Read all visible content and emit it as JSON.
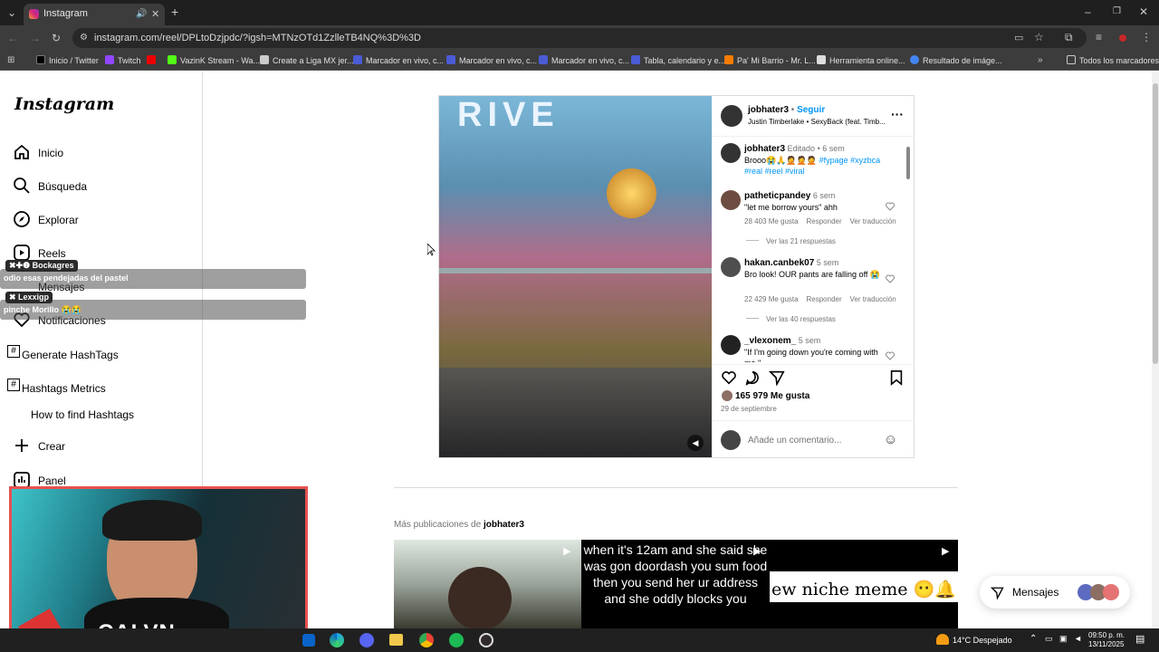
{
  "browser": {
    "tab_title": "Instagram",
    "url": "instagram.com/reel/DPLtoDzjpdc/?igsh=MTNzOTd1ZzlleTB4NQ%3D%3D",
    "bookmarks": [
      "Inicio / Twitter",
      "Twitch",
      "VazinK Stream - Wa...",
      "Create a Liga MX jer...",
      "Marcador en vivo, c...",
      "Marcador en vivo, c...",
      "Marcador en vivo, c...",
      "Tabla, calendario y e...",
      "Pa' Mi Barrio - Mr. L...",
      "Herramienta online...",
      "Resultado de imáge..."
    ],
    "all_bookmarks": "Todos los marcadores"
  },
  "sidebar": {
    "logo": "Instagram",
    "items": [
      "Inicio",
      "Búsqueda",
      "Explorar",
      "Reels",
      "Mensajes",
      "Notificaciones",
      "Generate HashTags",
      "Hashtags Metrics",
      "How to find Hashtags",
      "Crear",
      "Panel"
    ]
  },
  "chat": {
    "user1": "Bockagres",
    "msg1": "odio esas pendejadas del pastel",
    "user2": "Lexxigp",
    "msg2": "pinche Morillo 😭😭"
  },
  "webcam": {
    "name_text": "CALVN"
  },
  "post": {
    "username": "jobhater3",
    "follow": "Seguir",
    "audio": "Justin Timberlake • SexyBack (feat. Timb...",
    "caption_user": "jobhater3",
    "caption_edited": "Editado",
    "caption_time": "6 sem",
    "caption_text": "Brooo😭🙏🤦🤦🤦",
    "caption_tags": "#fypage #xyzbca",
    "caption_tags2": "#real #reel #viral",
    "comments": [
      {
        "user": "patheticpandey",
        "time": "6 sem",
        "text": "\"let me borrow yours\" ahh",
        "likes": "28 403 Me gusta",
        "reply": "Responder",
        "translate": "Ver traducción",
        "replies": "Ver las 21 respuestas"
      },
      {
        "user": "hakan.canbek07",
        "time": "5 sem",
        "text": "Bro look! OUR pants are falling off 😭",
        "likes": "22 429 Me gusta",
        "reply": "Responder",
        "translate": "Ver traducción",
        "replies": "Ver las 40 respuestas"
      },
      {
        "user": "_vlexonem_",
        "time": "5 sem",
        "text": "\"If I'm going down you're coming with me.\""
      }
    ],
    "likes": "165 979 Me gusta",
    "date": "29 de septiembre",
    "add_comment": "Añade un comentario..."
  },
  "more": {
    "label": "Más publicaciones de",
    "user": "jobhater3",
    "thumb2_text": "when it's 12am and she said she was gon doordash you sum food then you send her ur address and she oddly blocks you",
    "thumb3_text": "ew niche meme 😶🔔"
  },
  "messages_button": "Mensajes",
  "taskbar": {
    "weather": "14°C  Despejado",
    "time": "09:50 p. m.",
    "date": "13/11/2025"
  }
}
